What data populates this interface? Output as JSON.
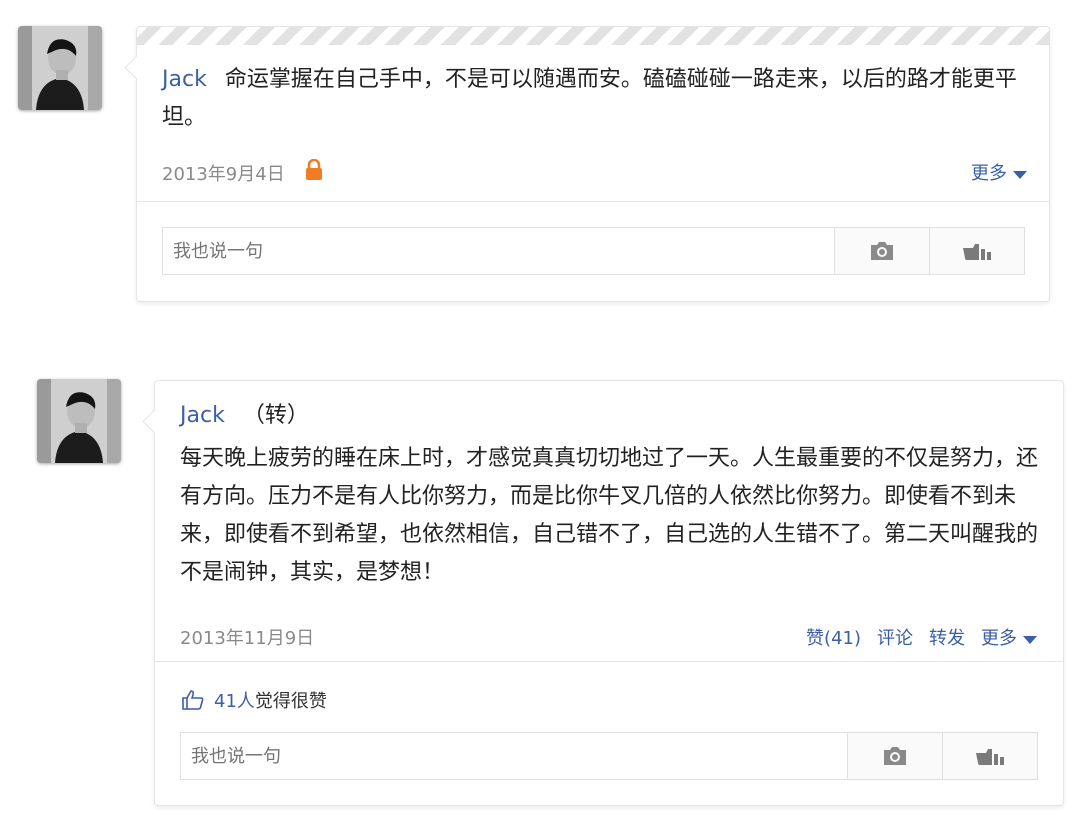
{
  "posts": [
    {
      "author": "Jack",
      "repost_tag": "",
      "content": "命运掌握在自己手中，不是可以随遇而安。磕磕碰碰一路走来，以后的路才能更平坦。",
      "date": "2013年9月4日",
      "private_icon": "lock-icon",
      "more_label": "更多",
      "reply_placeholder": "我也说一句"
    },
    {
      "author": "Jack",
      "repost_tag": "（转）",
      "content": "每天晚上疲劳的睡在床上时，才感觉真真切切地过了一天。人生最重要的不仅是努力，还有方向。压力不是有人比你努力，而是比你牛叉几倍的人依然比你努力。即使看不到未来，即使看不到希望，也依然相信，自己错不了，自己选的人生错不了。第二天叫醒我的不是闹钟，其实，是梦想！",
      "date": "2013年11月9日",
      "like_label": "赞(41)",
      "comment_label": "评论",
      "forward_label": "转发",
      "more_label": "更多",
      "likes_count": "41人",
      "likes_text": "觉得很赞",
      "reply_placeholder": "我也说一句"
    }
  ],
  "colors": {
    "link": "#3b5fa6",
    "lock": "#f07c24"
  }
}
